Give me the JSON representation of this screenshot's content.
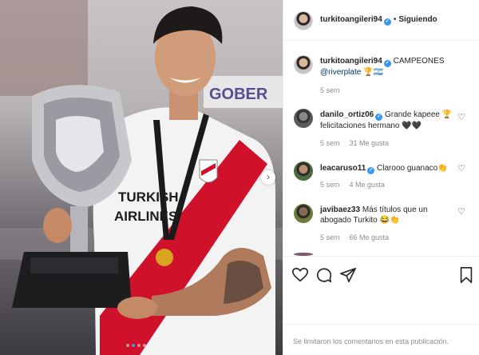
{
  "post": {
    "author": "turkitoangileri94",
    "follow_status": "Siguiendo",
    "separator": "•",
    "caption_text": "CAMPEONES",
    "caption_mention": "@riverplate",
    "caption_emoji": "🏆🇦🇷",
    "caption_time": "5 sem",
    "carousel": {
      "total": 6,
      "active": 1
    },
    "photo_texts": {
      "sponsor_line1": "TURKISH",
      "sponsor_line2": "AIRLINES",
      "bg_banner": "GOBER"
    }
  },
  "comments": [
    {
      "user": "danilo_ortiz06",
      "verified": true,
      "text": "Grande kapeee 🏆 felicitaciones hermano 🖤🖤",
      "time": "5 sem",
      "likes": "31 Me gusta"
    },
    {
      "user": "leacaruso11",
      "verified": true,
      "text": "Clarooo guanaco👏",
      "time": "5 sem",
      "likes": "4 Me gusta"
    },
    {
      "user": "javibaez33",
      "verified": false,
      "text": "Más títulos que un abogado Turkito 😂👏",
      "time": "5 sem",
      "likes": "66 Me gusta"
    }
  ],
  "footer": {
    "comments_limited": "Se limitaron los comentarios en esta publicación."
  },
  "icons": {
    "verified": "verified-badge-icon",
    "like": "heart-icon",
    "comment": "comment-icon",
    "share": "paper-plane-icon",
    "save": "bookmark-icon",
    "next": "chevron-right-icon"
  },
  "colors": {
    "link": "#00376b",
    "verified": "#3897f0",
    "muted": "#8e8e8e",
    "river_red": "#d0112b"
  }
}
